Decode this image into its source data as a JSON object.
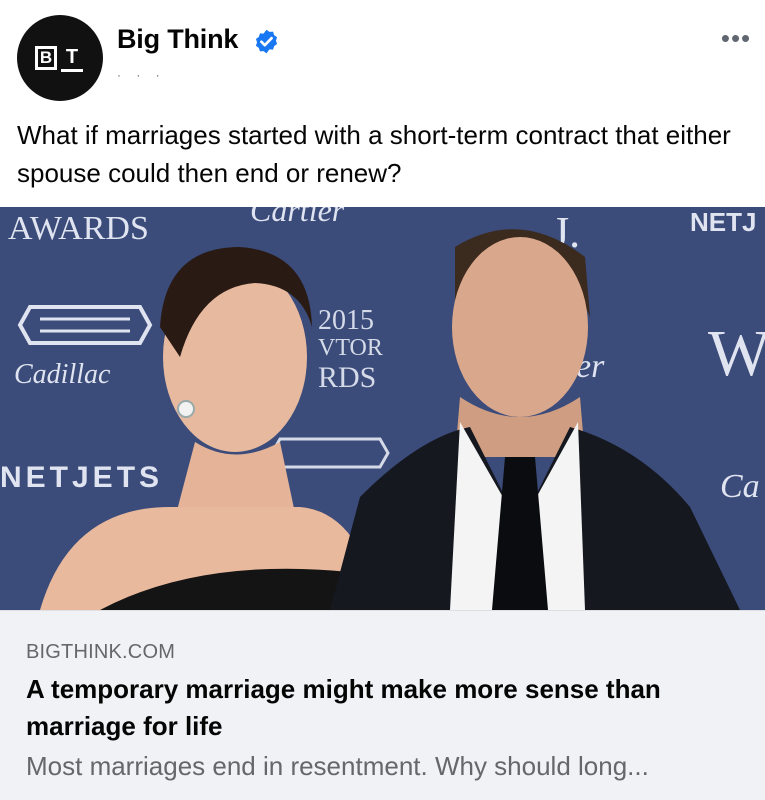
{
  "post": {
    "page_name": "Big Think",
    "avatar": {
      "logo_left": "B",
      "logo_right": "T"
    },
    "verified": true,
    "more_options_label": "•••",
    "meta_icon": "globe-icon",
    "text": "What if marriages started with a short-term contract that either spouse could then end or renew?"
  },
  "photo": {
    "background_text": [
      "AWARDS",
      "Cartier",
      "NETJ",
      "2015",
      "VTOR",
      "RDS",
      "Cadillac",
      "NETJETS",
      "er",
      "W",
      "J.",
      "Ca"
    ]
  },
  "link_preview": {
    "domain": "BIGTHINK.COM",
    "headline": "A temporary marriage might make more sense than marriage for life",
    "description": "Most marriages end in resentment. Why should long..."
  },
  "colors": {
    "verified": "#1877f2",
    "backdrop": "#3f4f80",
    "link_bg": "#f0f2f5",
    "secondary_text": "#65676b"
  }
}
